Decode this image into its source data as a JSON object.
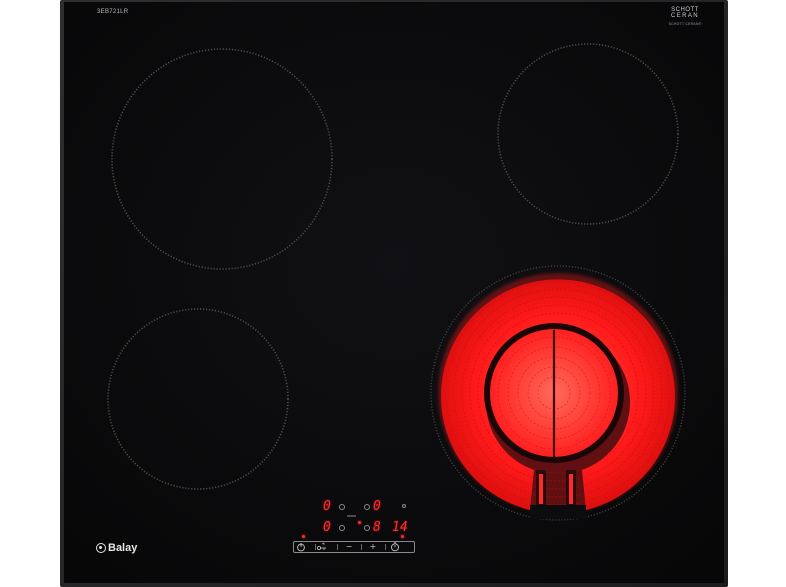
{
  "product": {
    "model_code": "3EB721LR",
    "glass_brand_line1": "SCHOTT",
    "glass_brand_line2": "CERAN",
    "glass_brand_line3": "SCHOTT CERAN®",
    "brand_name": "Balay"
  },
  "colors": {
    "glass": "#0d0d0f",
    "frame": "#2a2a2c",
    "zone_outline": "#4a4a4a",
    "heating_red": "#ff1e1e",
    "display_red": "#ff2a2a"
  },
  "display": {
    "top_left_digit": "0",
    "top_right_digit": "0",
    "bottom_left_digit": "0",
    "bottom_right_digit": "8",
    "timer_value": "14"
  },
  "controls": {
    "power_icon": "power-icon",
    "lock_icon": "child-lock-icon",
    "minus_label": "−",
    "plus_label": "+",
    "timer_icon": "timer-icon"
  },
  "zones": [
    {
      "name": "rear-left",
      "state": "off"
    },
    {
      "name": "rear-right",
      "state": "off"
    },
    {
      "name": "front-left",
      "state": "off"
    },
    {
      "name": "front-right-dual",
      "state": "on"
    }
  ]
}
